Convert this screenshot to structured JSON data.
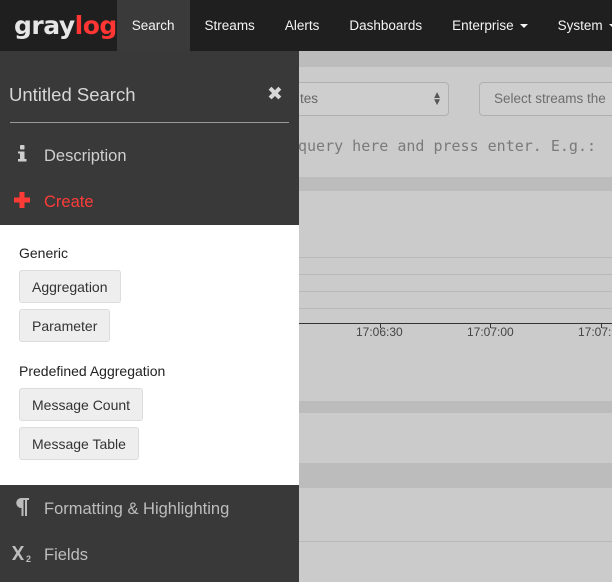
{
  "brand": {
    "part1": "gray",
    "part2": "log"
  },
  "nav": {
    "items": [
      {
        "label": "Search",
        "active": true
      },
      {
        "label": "Streams"
      },
      {
        "label": "Alerts"
      },
      {
        "label": "Dashboards"
      },
      {
        "label": "Enterprise",
        "dropdown": true
      },
      {
        "label": "System",
        "dropdown": true
      }
    ]
  },
  "background": {
    "timerange_value": "tes",
    "streams_placeholder": "Select streams the",
    "query_placeholder": "query here and press enter. E.g.:",
    "time_ticks": [
      "17:06:30",
      "17:07:00",
      "17:07:"
    ]
  },
  "panel": {
    "title": "Untitled Search",
    "close_icon": "close-icon",
    "description_label": "Description",
    "create_label": "Create",
    "generic_heading": "Generic",
    "generic_buttons": [
      "Aggregation",
      "Parameter"
    ],
    "predefined_heading": "Predefined Aggregation",
    "predefined_buttons": [
      "Message Count",
      "Message Table"
    ],
    "formatting_label": "Formatting & Highlighting",
    "fields_label": "Fields"
  },
  "colors": {
    "navbar": "#1f1f1f",
    "panel_dark": "#393939",
    "accent_red": "#ff3b38"
  }
}
